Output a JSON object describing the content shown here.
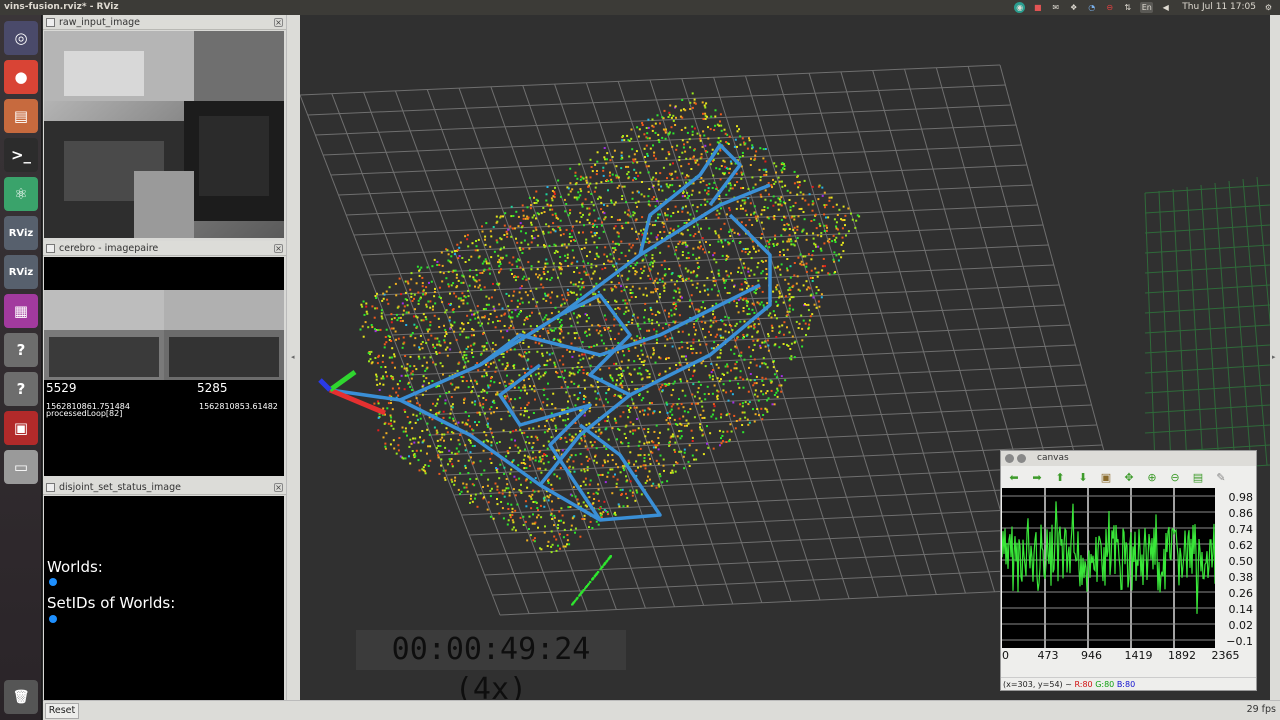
{
  "window_title": "vins-fusion.rviz* - RViz",
  "tray": {
    "lang": "En",
    "clock": "Thu Jul 11 17:05"
  },
  "launcher": [
    {
      "name": "ubuntu-dash-icon",
      "glyph": "◎",
      "color": "#4a4a6a"
    },
    {
      "name": "chrome-icon",
      "glyph": "●",
      "color": "#d94435"
    },
    {
      "name": "files-icon",
      "glyph": "▤",
      "color": "#c76a3e"
    },
    {
      "name": "terminal-icon",
      "glyph": ">_",
      "color": "#2c2c2c"
    },
    {
      "name": "atom-icon",
      "glyph": "⚛",
      "color": "#3aa36b"
    },
    {
      "name": "rviz-icon",
      "glyph": "RViz",
      "color": "#57606d"
    },
    {
      "name": "rviz-icon",
      "glyph": "RViz",
      "color": "#57606d"
    },
    {
      "name": "workspace-icon",
      "glyph": "▦",
      "color": "#a23a9e"
    },
    {
      "name": "unknown-app-icon",
      "glyph": "?",
      "color": "#6d6d6d"
    },
    {
      "name": "unknown-app-icon",
      "glyph": "?",
      "color": "#6d6d6d"
    },
    {
      "name": "app-icon",
      "glyph": "▣",
      "color": "#b22a2a"
    },
    {
      "name": "drive-icon",
      "glyph": "▭",
      "color": "#9a9a9a"
    }
  ],
  "panels": {
    "raw": {
      "title": "raw_input_image"
    },
    "cerebro": {
      "title": "cerebro - imagepaire",
      "left_id": "5529",
      "right_id": "5285",
      "left_stamp": "1562810861.751484",
      "right_stamp": "1562810853.61482",
      "processed": "processedLoop[82]"
    },
    "disjoint": {
      "title": "disjoint_set_status_image",
      "worlds": "Worlds:",
      "setids": "SetIDs of Worlds:"
    }
  },
  "view": {
    "timestamp": "00:00:49:24 (4x)"
  },
  "canvas": {
    "title": "canvas",
    "yticks": [
      "0.98",
      "0.86",
      "0.74",
      "0.62",
      "0.50",
      "0.38",
      "0.26",
      "0.14",
      "0.02",
      "−0.1"
    ],
    "xticks": [
      "0",
      "473",
      "946",
      "1419",
      "1892",
      "2365"
    ],
    "status_prefix": "(x=303, y=54) ~",
    "status_r": "R:80",
    "status_g": "G:80",
    "status_b": "B:80"
  },
  "bottom": {
    "reset": "Reset",
    "fps": "29 fps"
  }
}
